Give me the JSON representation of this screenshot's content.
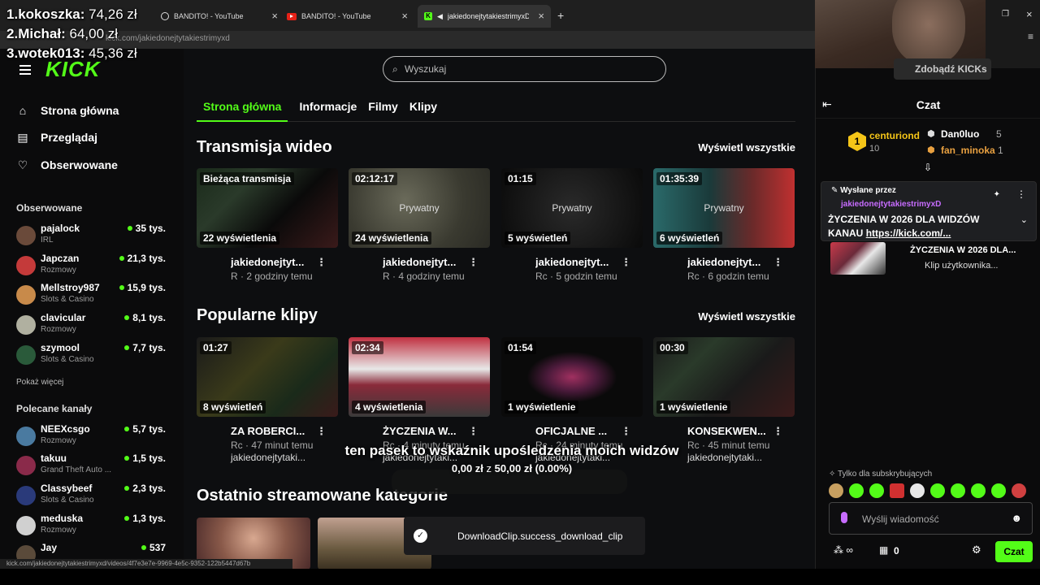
{
  "colors": {
    "kick_green": "#53fc18",
    "bg": "#0d0e10",
    "sidebar_bg": "#0b0b0c"
  },
  "browser": {
    "tabs": [
      {
        "title": "BANDITO! - YouTube",
        "icon": "youtube-icon"
      },
      {
        "title": "BANDITO! - YouTube",
        "icon": "youtube-icon"
      },
      {
        "title": "jakiedonejtytakiestrimyxD",
        "icon": "kick-icon"
      }
    ],
    "address": "kick.com/jakiedonejtytakiestrimyxd",
    "status_url": "kick.com/jakiedonejtytakiestrimyxd/videos/4f7e3e7e-9969-4e5c-9352-122b5447d67b"
  },
  "donors": [
    {
      "rank": "1.",
      "name": "kokoszka:",
      "amount": "74,26 zł"
    },
    {
      "rank": "2.",
      "name": "Michał:",
      "amount": "64,00 zł"
    },
    {
      "rank": "3.",
      "name": "wotek013:",
      "amount": "45,36 zł"
    }
  ],
  "search": {
    "placeholder": "Wyszukaj"
  },
  "sidebar": {
    "nav": [
      {
        "label": "Strona główna",
        "icon": "home-icon"
      },
      {
        "label": "Przeglądaj",
        "icon": "browse-icon"
      },
      {
        "label": "Obserwowane",
        "icon": "heart-icon"
      }
    ],
    "followed_title": "Obserwowane",
    "followed": [
      {
        "name": "pajalock",
        "category": "IRL",
        "viewers": "35 tys."
      },
      {
        "name": "Japczan",
        "category": "Rozmowy",
        "viewers": "21,3 tys."
      },
      {
        "name": "Mellstroy987",
        "category": "Slots & Casino",
        "viewers": "15,9 tys."
      },
      {
        "name": "clavicular",
        "category": "Rozmowy",
        "viewers": "8,1 tys."
      },
      {
        "name": "szymool",
        "category": "Slots & Casino",
        "viewers": "7,7 tys."
      }
    ],
    "show_more": "Pokaż więcej",
    "recommended_title": "Polecane kanały",
    "recommended": [
      {
        "name": "NEEXcsgo",
        "category": "Rozmowy",
        "viewers": "5,7 tys."
      },
      {
        "name": "takuu",
        "category": "Grand Theft Auto ...",
        "viewers": "1,5 tys."
      },
      {
        "name": "Classybeef",
        "category": "Slots & Casino",
        "viewers": "2,3 tys."
      },
      {
        "name": "meduska",
        "category": "Rozmowy",
        "viewers": "1,3 tys."
      },
      {
        "name": "Jay",
        "category": "",
        "viewers": "537"
      }
    ]
  },
  "main": {
    "tabs": [
      "Strona główna",
      "Informacje",
      "Filmy",
      "Klipy"
    ],
    "videos_title": "Transmisja wideo",
    "view_all": "Wyświetl wszystkie",
    "videos": [
      {
        "badge": "Bieżąca transmisja",
        "center": "",
        "views": "22 wyświetlenia",
        "title": "jakiedonejtyt...",
        "sub": "R · 2 godziny temu"
      },
      {
        "badge": "02:12:17",
        "center": "Prywatny",
        "views": "24 wyświetlenia",
        "title": "jakiedonejtyt...",
        "sub": "R · 4 godziny temu"
      },
      {
        "badge": "01:15",
        "center": "Prywatny",
        "views": "5 wyświetleń",
        "title": "jakiedonejtyt...",
        "sub": "Rc · 5 godzin temu"
      },
      {
        "badge": "01:35:39",
        "center": "Prywatny",
        "views": "6 wyświetleń",
        "title": "jakiedonejtyt...",
        "sub": "Rc · 6 godzin temu"
      }
    ],
    "clips_title": "Popularne klipy",
    "clips": [
      {
        "badge": "01:27",
        "views": "8 wyświetleń",
        "title": "ZA ROBERCI...",
        "sub": "Rc · 47 minut temu",
        "author": "jakiedonejtytaki..."
      },
      {
        "badge": "02:34",
        "views": "4 wyświetlenia",
        "title": "ŻYCZENIA W...",
        "sub": "Rc · 4 minuty temu",
        "author": "jakiedonejtytaki..."
      },
      {
        "badge": "01:54",
        "views": "1 wyświetlenie",
        "title": "OFICJALNE ...",
        "sub": "Rc · 24 minuty temu",
        "author": "jakiedonejtytaki..."
      },
      {
        "badge": "00:30",
        "views": "1 wyświetlenie",
        "title": "KONSEKWEN...",
        "sub": "Rc · 45 minut temu",
        "author": "jakiedonejtytaki..."
      }
    ],
    "categories_title": "Ostatnio streamowane kategorie"
  },
  "goal": {
    "text": "ten pasek to wskaźnik upośledzenia moich widzów",
    "current": "0,00 zł",
    "sep": "z",
    "target": "50,00 zł",
    "percent": "(0.00%)"
  },
  "toast": {
    "text": "DownloadClip.success_download_clip"
  },
  "chat": {
    "title": "Czat",
    "kicks_button": "Zdobądź KICKs",
    "leaderboard": [
      {
        "rank": "1",
        "name": "centuriond",
        "count": "10"
      },
      {
        "name": "Dan0luo",
        "count": "5"
      },
      {
        "name": "fan_minoka",
        "count": "1"
      }
    ],
    "pinned_label": "Wysłane przez",
    "pinned_author": "jakiedonejtytakiestrimyxD",
    "pinned_text": "ŻYCZENIA W 2026 DLA WIDZÓW KANAU",
    "pinned_link": "https://kick.com/...",
    "clip_title": "ŻYCZENIA W 2026 DLA...",
    "clip_sub": "Klip użytkownika...",
    "sub_only": "Tylko dla subskrybujących",
    "input_placeholder": "Wyślij wiadomość",
    "points": "0",
    "send_label": "Czat"
  }
}
